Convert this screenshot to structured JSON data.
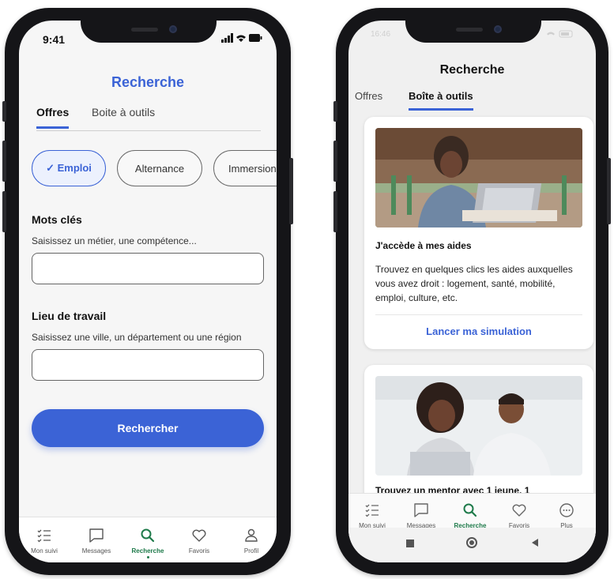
{
  "left_phone": {
    "status_time": "9:41",
    "title": "Recherche",
    "tabs": [
      {
        "label": "Offres",
        "active": true
      },
      {
        "label": "Boite à outils",
        "active": false
      }
    ],
    "chips": [
      {
        "label": "✓  Emploi",
        "active": true
      },
      {
        "label": "Alternance",
        "active": false
      },
      {
        "label": "Immersion",
        "active": false
      }
    ],
    "keywords": {
      "title": "Mots clés",
      "hint": "Saisissez un métier, une compétence...",
      "value": ""
    },
    "location": {
      "title": "Lieu de travail",
      "hint": "Saisissez une ville, un département ou une région",
      "value": ""
    },
    "search_button": "Rechercher",
    "nav": [
      {
        "label": "Mon suivi",
        "icon": "checklist-icon",
        "active": false
      },
      {
        "label": "Messages",
        "icon": "message-icon",
        "active": false
      },
      {
        "label": "Recherche",
        "icon": "search-icon",
        "active": true
      },
      {
        "label": "Favoris",
        "icon": "heart-icon",
        "active": false
      },
      {
        "label": "Profil",
        "icon": "profile-icon",
        "active": false
      }
    ]
  },
  "right_phone": {
    "status_time": "16:46",
    "title": "Recherche",
    "tabs": [
      {
        "label": "Offres",
        "active": false
      },
      {
        "label": "Boîte à outils",
        "active": true
      }
    ],
    "cards": [
      {
        "title": "J'accède à mes aides",
        "body": "Trouvez en quelques clics les aides auxquelles vous avez droit : logement, santé, mobilité, emploi, culture, etc.",
        "link": "Lancer ma simulation"
      },
      {
        "title": "Trouvez un mentor avec 1 jeune, 1"
      }
    ],
    "nav": [
      {
        "label": "Mon suivi",
        "icon": "checklist-icon",
        "active": false
      },
      {
        "label": "Messages",
        "icon": "message-icon",
        "active": false
      },
      {
        "label": "Recherche",
        "icon": "search-icon",
        "active": true
      },
      {
        "label": "Favoris",
        "icon": "heart-icon",
        "active": false
      },
      {
        "label": "Plus",
        "icon": "more-icon",
        "active": false
      }
    ]
  },
  "colors": {
    "accent": "#3b63d6",
    "nav_active": "#1e7a4a"
  }
}
